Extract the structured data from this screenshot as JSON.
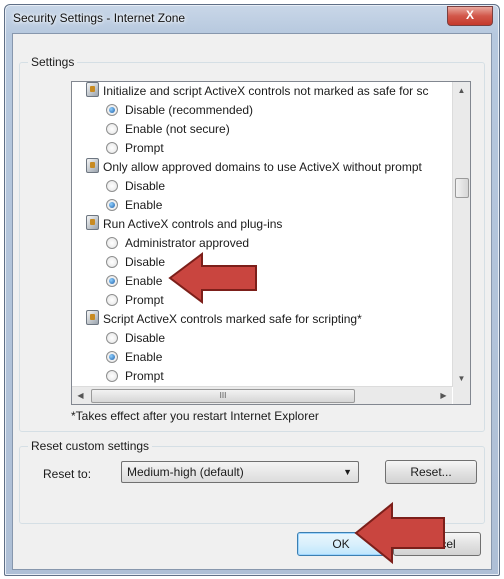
{
  "window": {
    "title": "Security Settings - Internet Zone",
    "close_glyph": "X"
  },
  "settings": {
    "group_label": "Settings",
    "rows": [
      {
        "type": "header",
        "label": "Initialize and script ActiveX controls not marked as safe for sc",
        "icon": "activex-setting-icon"
      },
      {
        "type": "option",
        "label": "Disable (recommended)",
        "checked": true
      },
      {
        "type": "option",
        "label": "Enable (not secure)",
        "checked": false
      },
      {
        "type": "option",
        "label": "Prompt",
        "checked": false
      },
      {
        "type": "header",
        "label": "Only allow approved domains to use ActiveX without prompt",
        "icon": "activex-setting-icon"
      },
      {
        "type": "option",
        "label": "Disable",
        "checked": false
      },
      {
        "type": "option",
        "label": "Enable",
        "checked": true
      },
      {
        "type": "header",
        "label": "Run ActiveX controls and plug-ins",
        "icon": "activex-setting-icon"
      },
      {
        "type": "option",
        "label": "Administrator approved",
        "checked": false
      },
      {
        "type": "option",
        "label": "Disable",
        "checked": false
      },
      {
        "type": "option",
        "label": "Enable",
        "checked": true
      },
      {
        "type": "option",
        "label": "Prompt",
        "checked": false
      },
      {
        "type": "header",
        "label": "Script ActiveX controls marked safe for scripting*",
        "icon": "activex-setting-icon"
      },
      {
        "type": "option",
        "label": "Disable",
        "checked": false
      },
      {
        "type": "option",
        "label": "Enable",
        "checked": true
      },
      {
        "type": "option",
        "label": "Prompt",
        "checked": false
      }
    ],
    "footnote": "*Takes effect after you restart Internet Explorer",
    "hscroll_grip": "III"
  },
  "reset": {
    "group_label": "Reset custom settings",
    "reset_to_label": "Reset to:",
    "selected_level": "Medium-high (default)",
    "reset_button": "Reset..."
  },
  "buttons": {
    "ok": "OK",
    "cancel": "Cancel"
  },
  "colors": {
    "callout_arrow": "#c9453f",
    "highlight": "#ffffff"
  }
}
